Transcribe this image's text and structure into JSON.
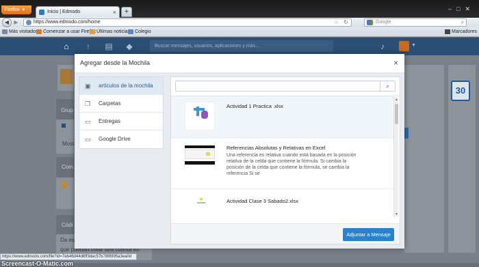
{
  "browser": {
    "menu_label": "Firefox",
    "tab_title": "Inicio | Edmodo",
    "new_tab": "+",
    "url": "https://www.edmodo.com/home",
    "search_engine": "Google",
    "bookmarks": [
      "Más visitados",
      "Comenzar a usar Firefox",
      "Últimas noticias",
      "Colegio"
    ],
    "bookmarks_right": "Marcadores",
    "status_url": "https://www.edmodo.com/file?id=7eb46d44d6ff3dac57b78f8995a3ea0d"
  },
  "edmodo": {
    "search_placeholder": "Buscar mensajes, usuarios, aplicaciones y más...",
    "calendar_day": "30",
    "background_fragments": [
      "Grup",
      "Most",
      "Com",
      "Códi",
      "Da es",
      "que puedan crear una cuenta en"
    ]
  },
  "modal": {
    "title": "Agregar desde la Mochila",
    "menu": [
      {
        "label": "artículos de la mochila",
        "icon": "backpack-icon",
        "active": true
      },
      {
        "label": "Carpetas",
        "icon": "folder-icon",
        "active": false
      },
      {
        "label": "Entregas",
        "icon": "assignment-icon",
        "active": false
      },
      {
        "label": "Google Drive",
        "icon": "drive-icon",
        "active": false
      }
    ],
    "search_value": "",
    "items": [
      {
        "name": "Actividad 1 Practica .xlsx",
        "desc": ""
      },
      {
        "name": "Referencias Absolutas y Relativas en Excel",
        "desc": "Una referencia es relativa cuando está basada en la posición relativa de la celda que contiene la fórmula. Si cambia la posición de la celda que contiene la fórmula, se cambia la referencia Si se"
      },
      {
        "name": "Actividad Clase 3 Sabado2.xlsx",
        "desc": ""
      }
    ],
    "attach_button": "Adjuntar a Mensaje"
  },
  "watermark": "Screencast-O-Matic.com",
  "colors": {
    "edmodo_nav": "#2b4e74",
    "primary_button": "#2a82cf",
    "firefox_orange": "#e2701a"
  }
}
